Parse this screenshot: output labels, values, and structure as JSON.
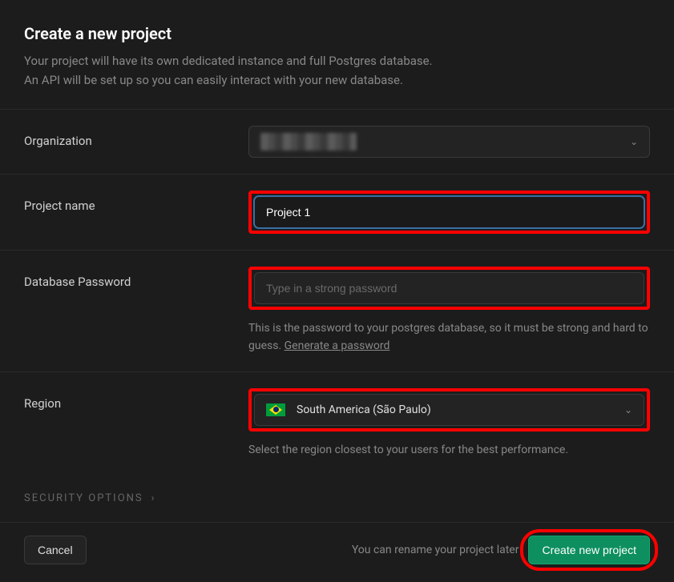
{
  "header": {
    "title": "Create a new project",
    "subtitle1": "Your project will have its own dedicated instance and full Postgres database.",
    "subtitle2": "An API will be set up so you can easily interact with your new database."
  },
  "form": {
    "organization": {
      "label": "Organization"
    },
    "project_name": {
      "label": "Project name",
      "value": "Project 1"
    },
    "database_password": {
      "label": "Database Password",
      "placeholder": "Type in a strong password",
      "helper_pre": "This is the password to your postgres database, so it must be strong and hard to guess. ",
      "generate_link": "Generate a password"
    },
    "region": {
      "label": "Region",
      "selected": "South America (São Paulo)",
      "helper": "Select the region closest to your users for the best performance."
    }
  },
  "security_options": {
    "label": "Security Options"
  },
  "footer": {
    "cancel": "Cancel",
    "rename_hint": "You can rename your project later",
    "create": "Create new project"
  }
}
